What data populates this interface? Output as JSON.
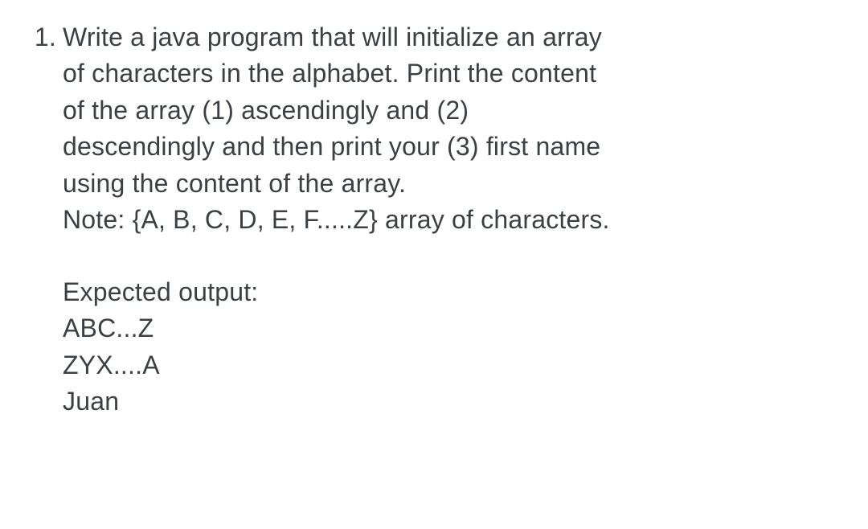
{
  "question": {
    "number": "1.",
    "prompt_line1": "Write a java program that will initialize an array",
    "prompt_line2": "of characters in the alphabet. Print the content",
    "prompt_line3": "of the array (1) ascendingly and (2)",
    "prompt_line4": "descendingly and then print your (3) first name",
    "prompt_line5": "using the content of the array.",
    "note_line": "Note: {A, B, C, D, E, F.....Z} array of characters.",
    "expected_label": "Expected output:",
    "expected_out1": "ABC...Z",
    "expected_out2": "ZYX....A",
    "expected_out3": "Juan"
  }
}
